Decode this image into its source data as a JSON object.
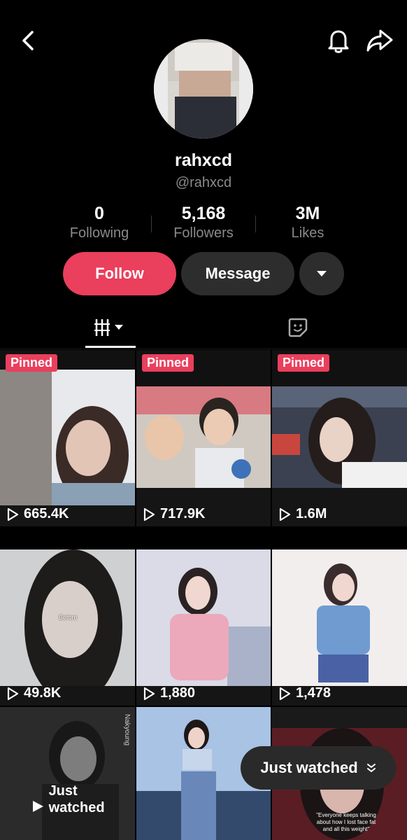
{
  "profile": {
    "username": "rahxcd",
    "handle": "@rahxcd",
    "stats": [
      {
        "value": "0",
        "label": "Following"
      },
      {
        "value": "5,168",
        "label": "Followers"
      },
      {
        "value": "3M",
        "label": "Likes"
      }
    ]
  },
  "actions": {
    "follow_label": "Follow",
    "message_label": "Message"
  },
  "tabs": {
    "videos_icon": "grid-icon",
    "liked_icon": "sticker-icon"
  },
  "videos": [
    {
      "pinned": "Pinned",
      "views": "665.4K"
    },
    {
      "pinned": "Pinned",
      "views": "717.9K"
    },
    {
      "pinned": "Pinned",
      "views": "1.6M"
    },
    {
      "views": "49.8K",
      "overlay_text": "Before"
    },
    {
      "views": "1,880"
    },
    {
      "views": "1,478"
    },
    {
      "badge": "Just watched",
      "side_text": "Nakyoung"
    },
    {},
    {
      "caption": "\"Everyone keeps talking about how I lost face fat and all this weight\""
    }
  ],
  "toast": {
    "label": "Just watched"
  },
  "colors": {
    "accent": "#ea3f5d",
    "button_dark": "#2d2d2d",
    "background": "#000000"
  }
}
